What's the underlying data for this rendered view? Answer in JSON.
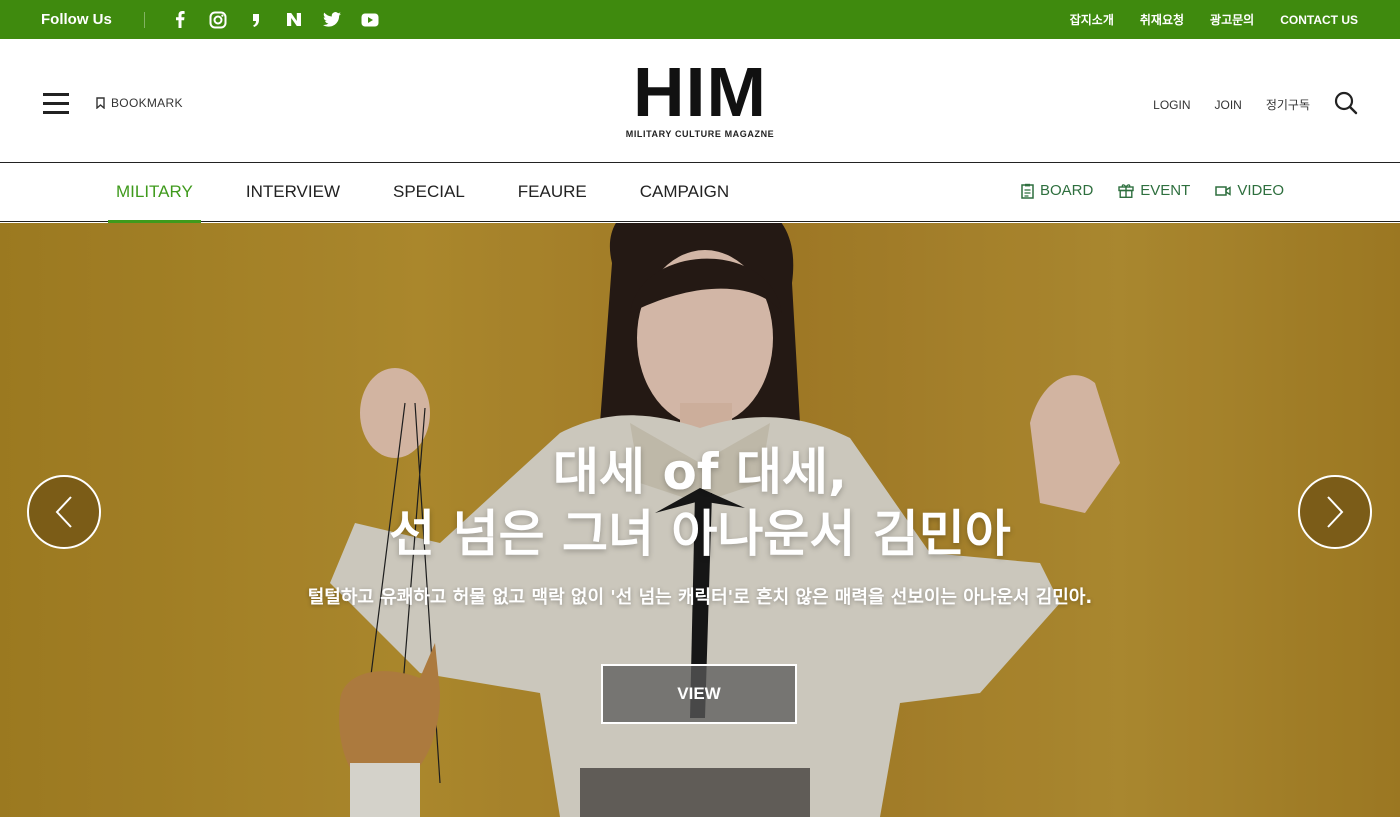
{
  "topbar": {
    "follow_label": "Follow Us",
    "social_icons": [
      "facebook-icon",
      "instagram-icon",
      "comma-icon",
      "naver-icon",
      "twitter-icon",
      "youtube-icon"
    ],
    "links": [
      "잡지소개",
      "취재요청",
      "광고문의",
      "CONTACT US"
    ],
    "bg_color": "#3f8a0e"
  },
  "header": {
    "bookmark_label": "BOOKMARK",
    "logo": "HIM",
    "logo_sub": "MILITARY CULTURE MAGAZNE",
    "login_label": "LOGIN",
    "join_label": "JOIN",
    "subscribe_label": "정기구독"
  },
  "nav": {
    "items": [
      {
        "label": "MILITARY",
        "active": true
      },
      {
        "label": "INTERVIEW",
        "active": false
      },
      {
        "label": "SPECIAL",
        "active": false
      },
      {
        "label": "FEAURE",
        "active": false
      },
      {
        "label": "CAMPAIGN",
        "active": false
      }
    ],
    "links": [
      {
        "label": "BOARD",
        "icon": "clipboard-icon"
      },
      {
        "label": "EVENT",
        "icon": "gift-icon"
      },
      {
        "label": "VIDEO",
        "icon": "video-camera-icon"
      }
    ],
    "accent_color": "#3f9a1c",
    "link_color": "#2e6f3e"
  },
  "hero": {
    "title_line1": "대세 of 대세,",
    "title_line2": "선 넘은 그녀 아나운서 김민아",
    "description": "털털하고 유쾌하고 허물 없고 맥락 없이 '선 넘는 캐릭터'로 흔치 않은 매력을 선보이는 아나운서 김민아.",
    "button_label": "VIEW",
    "bg_color": "#c29a33"
  }
}
